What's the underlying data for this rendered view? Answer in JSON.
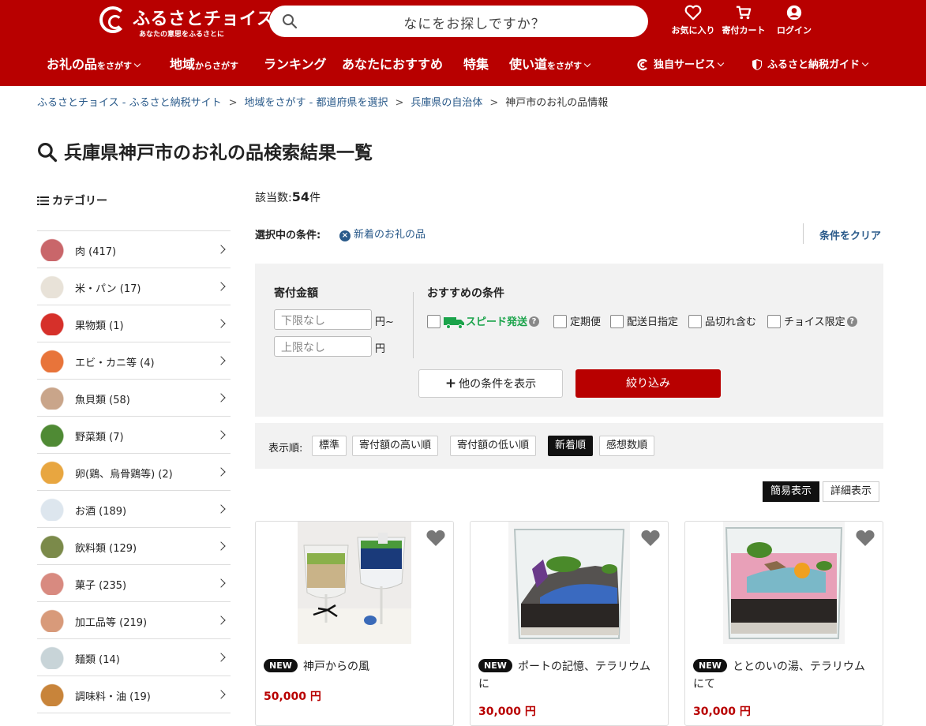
{
  "header": {
    "logo_name": "ふるさとチョイス",
    "logo_tagline": "あなたの意思をふるさとに",
    "search_placeholder": "なにをお探しですか？",
    "icons": [
      {
        "label": "お気に入り",
        "icon": "heart-icon"
      },
      {
        "label": "寄付カート",
        "icon": "cart-icon"
      },
      {
        "label": "ログイン",
        "icon": "user-icon"
      }
    ],
    "nav": [
      {
        "main": "お礼の品",
        "sub": "をさがす"
      },
      {
        "main": "地域",
        "sub": "からさがす"
      },
      {
        "main": "ランキング",
        "sub": ""
      },
      {
        "main": "あなたにおすすめ",
        "sub": ""
      },
      {
        "main": "特集",
        "sub": ""
      },
      {
        "main": "使い道",
        "sub": "をさがす"
      }
    ],
    "right_nav": [
      {
        "label": "独自サービス",
        "icon": "choice-logo-icon"
      },
      {
        "label": "ふるさと納税ガイド",
        "icon": "shield-icon"
      }
    ]
  },
  "breadcrumb": [
    "ふるさとチョイス - ふるさと納税サイト",
    "地域をさがす - 都道府県を選択",
    "兵庫県の自治体",
    "神戸市のお礼の品情報"
  ],
  "page_title": "兵庫県神戸市のお礼の品検索結果一覧",
  "sidebar": {
    "heading": "カテゴリー",
    "categories": [
      {
        "label": "肉 (417)",
        "color": "#c9666a"
      },
      {
        "label": "米・パン (17)",
        "color": "#e8e2d8"
      },
      {
        "label": "果物類 (1)",
        "color": "#d6302a"
      },
      {
        "label": "エビ・カニ等 (4)",
        "color": "#e8743a"
      },
      {
        "label": "魚貝類 (58)",
        "color": "#c9a58a"
      },
      {
        "label": "野菜類 (7)",
        "color": "#4f8a34"
      },
      {
        "label": "卵(鶏、烏骨鶏等) (2)",
        "color": "#e8a640"
      },
      {
        "label": "お酒 (189)",
        "color": "#dde6ee"
      },
      {
        "label": "飲料類 (129)",
        "color": "#7b8a4a"
      },
      {
        "label": "菓子 (235)",
        "color": "#d88a80"
      },
      {
        "label": "加工品等 (219)",
        "color": "#d89a7a"
      },
      {
        "label": "麺類 (14)",
        "color": "#c8d4d8"
      },
      {
        "label": "調味料・油 (19)",
        "color": "#c8843a"
      }
    ]
  },
  "results": {
    "count_label": "該当数:",
    "count_value": "54",
    "count_unit": "件",
    "selected_label": "選択中の条件:",
    "selected_tag": "新着のお礼の品",
    "clear_label": "条件をクリア"
  },
  "filter": {
    "amount_label": "寄付金額",
    "min_placeholder": "下限なし",
    "min_unit": "円~",
    "max_placeholder": "上限なし",
    "max_unit": "円",
    "recommend_label": "おすすめの条件",
    "options": [
      "スピード発送",
      "定期便",
      "配送日指定",
      "品切れ含む",
      "チョイス限定"
    ],
    "more_label": "他の条件を表示",
    "narrow_label": "絞り込み"
  },
  "sort": {
    "label": "表示順:",
    "options": [
      "標準",
      "寄付額の高い順",
      "寄付額の低い順",
      "新着順",
      "感想数順"
    ],
    "active": "新着順"
  },
  "view": {
    "options": [
      "簡易表示",
      "詳細表示"
    ],
    "active": "簡易表示"
  },
  "products": [
    {
      "badge": "NEW",
      "title": "神戸からの風",
      "price": "50,000 円"
    },
    {
      "badge": "NEW",
      "title": "ポートの記憶、テラリウムに",
      "price": "30,000 円"
    },
    {
      "badge": "NEW",
      "title": "ととのいの湯、テラリウムにて",
      "price": "30,000 円"
    }
  ],
  "colors": {
    "brand": "#b80000",
    "link": "#2a5a8a",
    "speed": "#1aa34a"
  }
}
